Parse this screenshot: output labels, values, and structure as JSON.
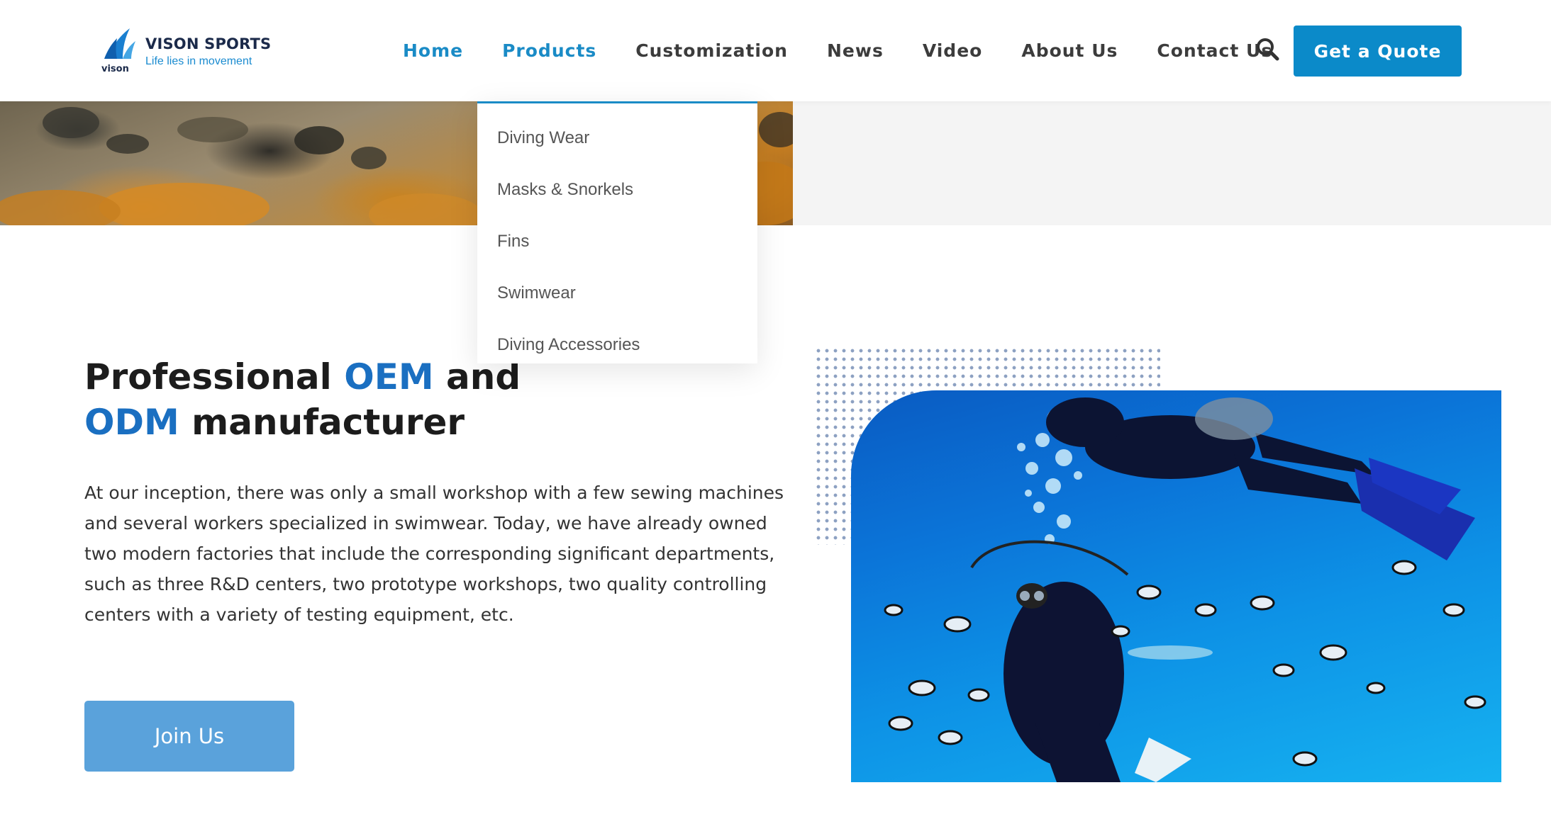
{
  "logo": {
    "brand": "VISON SPORTS",
    "tagline": "Life lies in movement",
    "mark_text": "vison"
  },
  "nav": {
    "items": [
      {
        "label": "Home"
      },
      {
        "label": "Products"
      },
      {
        "label": "Customization"
      },
      {
        "label": "News"
      },
      {
        "label": "Video"
      },
      {
        "label": "About Us"
      },
      {
        "label": "Contact Us"
      }
    ],
    "active": "Products",
    "search_icon": "search-icon",
    "quote_label": "Get a Quote"
  },
  "dropdown": {
    "items": [
      {
        "label": "Diving Wear"
      },
      {
        "label": "Masks & Snorkels"
      },
      {
        "label": "Fins"
      },
      {
        "label": "Swimwear"
      },
      {
        "label": "Diving Accessories"
      }
    ]
  },
  "hero": {
    "title_part1": "Professional ",
    "title_hl1": "OEM",
    "title_part2": " and",
    "title_hl2": "ODM",
    "title_part3": " manufacturer",
    "paragraph": "At our inception, there was only a small workshop with a few sewing machines and several workers specialized in swimwear. Today, we have already owned two modern factories that include the corresponding significant departments, such as three R&D centers, two prototype workshops, two quality controlling centers with a variety of testing equipment, etc.",
    "join_label": "Join Us"
  },
  "colors": {
    "accent": "#1a8bc6",
    "quote_button": "#0b8ac9",
    "headline_highlight": "#1a6fc1",
    "join_button": "#5aa2db",
    "dots": "#8da1c2"
  }
}
